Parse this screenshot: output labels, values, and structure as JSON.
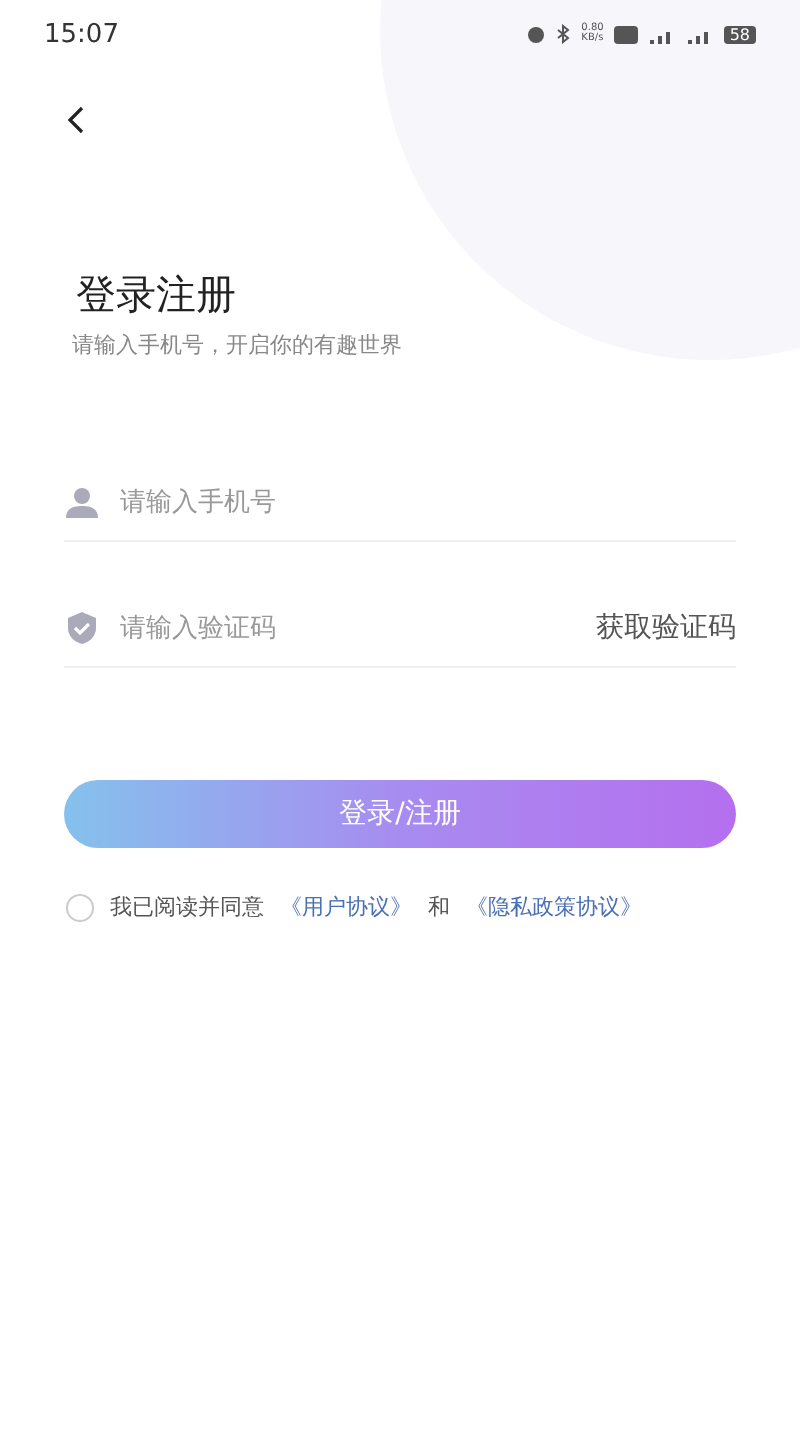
{
  "status_bar": {
    "time": "15:07",
    "speed_value": "0.80",
    "speed_unit": "KB/s",
    "battery": "58"
  },
  "title": "登录注册",
  "subtitle": "请输入手机号，开启你的有趣世界",
  "phone_field": {
    "placeholder": "请输入手机号"
  },
  "code_field": {
    "placeholder": "请输入验证码",
    "action": "获取验证码"
  },
  "submit_button": "登录/注册",
  "agreement": {
    "checked": false,
    "text": "我已阅读并同意",
    "links": [
      {
        "label": "《用户协议》"
      },
      {
        "label": "《隐私政策协议》"
      }
    ],
    "joiner": "和"
  }
}
